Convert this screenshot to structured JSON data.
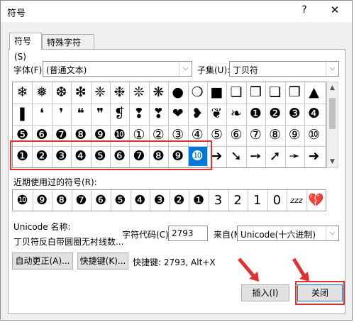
{
  "window": {
    "title": "符号",
    "help": "?",
    "close": "✕"
  },
  "tabs": [
    {
      "label": "符号(S)"
    },
    {
      "label": "特殊字符(P)"
    }
  ],
  "font": {
    "label": "字体(F):",
    "value": "(普通文本)"
  },
  "subset": {
    "label": "子集(U):",
    "value": "丁贝符"
  },
  "symbol_grid": {
    "rows": [
      [
        "❄",
        "❅",
        "❆",
        "❇",
        "❈",
        "❉",
        "❊",
        "❋",
        "●",
        "❍",
        "■",
        "❏",
        "❐",
        "❑",
        "❒",
        "▲",
        "▼",
        "◆",
        "❖",
        "◗",
        "❘",
        "❙",
        "❚"
      ],
      [
        "❚",
        "❛",
        "❜",
        "❝",
        "❞",
        "❡",
        "❢",
        "❣",
        "❤",
        "❥",
        "❦",
        "❧",
        "❶",
        "❷",
        "❸",
        "❹",
        "",
        "",
        "",
        "",
        "",
        "",
        ""
      ],
      [
        "❺",
        "❻",
        "❼",
        "❽",
        "❾",
        "❿",
        "①",
        "②",
        "③",
        "④",
        "⑤",
        "⑥",
        "⑦",
        "⑧",
        "⑨",
        "⑩",
        "",
        "",
        "",
        "",
        "",
        "",
        ""
      ],
      [
        "❶",
        "❷",
        "❸",
        "❹",
        "❺",
        "❻",
        "❼",
        "❽",
        "❾",
        "❿",
        "➔",
        "➘",
        "➙",
        "➚",
        "➛",
        "➜",
        "",
        "",
        "",
        "",
        "",
        "",
        ""
      ]
    ]
  },
  "recent": {
    "label": "近期使用过的符号(R):",
    "symbols": [
      "❿",
      "❾",
      "❽",
      "❼",
      "❻",
      "❺",
      "❹",
      "❸",
      "❷",
      "❶",
      "3",
      "2",
      "1",
      "0",
      "zzz",
      "💔"
    ]
  },
  "unicode_name": {
    "label": "Unicode 名称:",
    "value": "丁贝符反白带圆圈无衬线数..."
  },
  "char_code": {
    "label": "字符代码(C):",
    "value": "2793"
  },
  "from": {
    "label": "来自(M):",
    "value": "Unicode(十六进制)"
  },
  "buttons": {
    "autocorrect": "自动更正(A)...",
    "shortcut_key": "快捷键(K)...",
    "shortcut_text": "快捷键: 2793, Alt+X",
    "insert": "插入(I)",
    "close": "关闭"
  },
  "colors": {
    "accent": "#0078d7",
    "annotation": "#e03030"
  }
}
